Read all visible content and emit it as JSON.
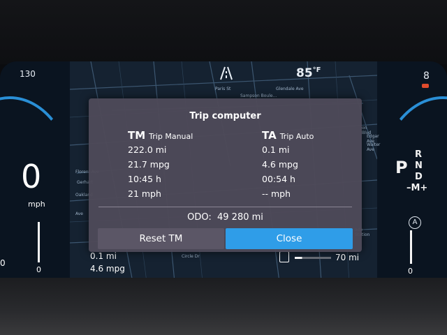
{
  "status": {
    "left_speed_limit": "130",
    "road_icon": "road-icon",
    "temperature": "85",
    "temp_unit": "°F",
    "right_number": "8"
  },
  "speedo": {
    "value": "0",
    "unit": "mph",
    "scale_zero": "0"
  },
  "tacho": {
    "scale_zero": "0"
  },
  "gears": {
    "selected": "P",
    "list": [
      "R",
      "N",
      "D"
    ],
    "manual": "–M+"
  },
  "map": {
    "labels": [
      "Paris St",
      "Glendale Ave",
      "Sampson Boule...",
      "Florent Ave",
      "Gerhart",
      "Oakland",
      "Ave",
      "on Blvd",
      "Edgar Ave",
      "Walter Ave",
      "Circle Dr",
      "ade Station"
    ]
  },
  "trip_computer": {
    "title": "Trip computer",
    "tm": {
      "code": "TM",
      "label": "Trip Manual",
      "distance": "222.0 mi",
      "economy": "21.7 mpg",
      "time": "10:45 h",
      "speed": "21 mph"
    },
    "ta": {
      "code": "TA",
      "label": "Trip Auto",
      "distance": "0.1 mi",
      "economy": "4.6 mpg",
      "time": "00:54 h",
      "speed": "-- mph"
    },
    "odo_label": "ODO:",
    "odo_value": "49 280 mi",
    "reset_label": "Reset TM",
    "close_label": "Close"
  },
  "bottom": {
    "trip_distance": "0.1 mi",
    "trip_economy": "4.6 mpg",
    "range": "70 mi",
    "left_edge": "0",
    "fuel_icon": "fuel-pump-icon"
  },
  "colors": {
    "accent": "#2f9de8",
    "modal_bg": "#4e4a58",
    "gauge_arc": "#2a8fd6"
  }
}
